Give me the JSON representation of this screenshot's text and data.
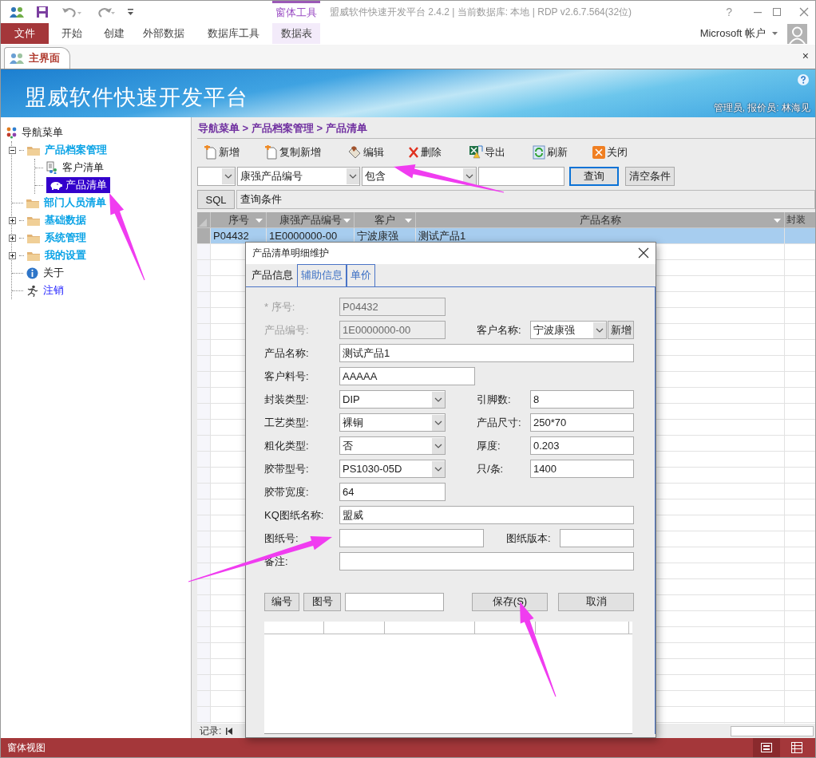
{
  "title_bar": {
    "context_group": "窗体工具",
    "title": "盟威软件快速开发平台 2.4.2 | 当前数据库: 本地 | RDP v2.6.7.564(32位)",
    "help": "?"
  },
  "ribbon": {
    "tabs": [
      {
        "label": "文件",
        "kind": "file"
      },
      {
        "label": "开始",
        "kind": "tab"
      },
      {
        "label": "创建",
        "kind": "tab"
      },
      {
        "label": "外部数据",
        "kind": "tab"
      },
      {
        "label": "数据库工具",
        "kind": "tab"
      },
      {
        "label": "数据表",
        "kind": "context"
      }
    ],
    "account": "Microsoft 帐户"
  },
  "document_tabs": {
    "tabs": [
      {
        "label": "主界面",
        "selected": true
      }
    ],
    "close": "×"
  },
  "banner": {
    "title": "盟威软件快速开发平台",
    "user": "管理员, 报价员: 林海见"
  },
  "nav": {
    "title": "导航菜单",
    "items": [
      {
        "label": "产品档案管理",
        "kind": "folder",
        "expanded": true,
        "children": [
          {
            "label": "客户清单",
            "kind": "table",
            "selected": false
          },
          {
            "label": "产品清单",
            "kind": "form",
            "selected": true
          }
        ]
      },
      {
        "label": "部门人员清单",
        "kind": "folder"
      },
      {
        "label": "基础数据",
        "kind": "folder",
        "expanded": false
      },
      {
        "label": "系统管理",
        "kind": "folder",
        "expanded": false
      },
      {
        "label": "我的设置",
        "kind": "folder",
        "expanded": false
      },
      {
        "label": "关于",
        "kind": "about"
      },
      {
        "label": "注销",
        "kind": "logout"
      }
    ]
  },
  "breadcrumb": "导航菜单 > 产品档案管理 > 产品清单",
  "toolbar": [
    {
      "label": "新增",
      "kind": "add"
    },
    {
      "label": "复制新增",
      "kind": "copy"
    },
    {
      "label": "编辑",
      "kind": "edit"
    },
    {
      "label": "删除",
      "kind": "delete"
    },
    {
      "label": "导出",
      "kind": "export"
    },
    {
      "label": "刷新",
      "kind": "refresh"
    },
    {
      "label": "关闭",
      "kind": "close"
    }
  ],
  "filter": {
    "field": "康强产品编号",
    "operator": "包含",
    "query_button": "查询",
    "clear_button": "清空条件"
  },
  "sql_bar": {
    "button": "SQL",
    "label": "查询条件"
  },
  "grid": {
    "columns": [
      "序号",
      "康强产品编号",
      "客户",
      "产品名称",
      "封装"
    ],
    "rows": [
      {
        "cells": [
          "P04432",
          "1E0000000-00",
          "宁波康强",
          "测试产品1"
        ],
        "selected": true
      }
    ]
  },
  "record_nav": {
    "label": "记录:"
  },
  "dialog": {
    "title": "产品清单明细维护",
    "tabs": [
      {
        "label": "产品信息",
        "selected": true
      },
      {
        "label": "辅助信息",
        "selected": false
      },
      {
        "label": "单价",
        "selected": false
      }
    ],
    "rows": [
      [
        {
          "label": "* 序号:",
          "value": "P04432",
          "kind": "readonly"
        }
      ],
      [
        {
          "label": "产品编号:",
          "value": "1E0000000-00",
          "kind": "readonly"
        },
        {
          "label": "客户名称:",
          "value": "宁波康强",
          "kind": "combo",
          "button": "新增"
        }
      ],
      [
        {
          "label": "产品名称:",
          "value": "测试产品1",
          "kind": "text"
        }
      ],
      [
        {
          "label": "客户料号:",
          "value": "AAAAA",
          "kind": "text"
        }
      ],
      [
        {
          "label": "封装类型:",
          "value": "DIP",
          "kind": "combo"
        },
        {
          "label": "引脚数:",
          "value": "8",
          "kind": "text"
        }
      ],
      [
        {
          "label": "工艺类型:",
          "value": "裸铜",
          "kind": "combo"
        },
        {
          "label": "产品尺寸:",
          "value": "250*70",
          "kind": "text"
        }
      ],
      [
        {
          "label": "粗化类型:",
          "value": "否",
          "kind": "combo"
        },
        {
          "label": "厚度:",
          "value": "0.203",
          "kind": "text"
        }
      ],
      [
        {
          "label": "胶带型号:",
          "value": "PS1030-05D",
          "kind": "combo"
        },
        {
          "label": "只/条:",
          "value": "1400",
          "kind": "text"
        }
      ],
      [
        {
          "label": "胶带宽度:",
          "value": "64",
          "kind": "text"
        }
      ],
      [
        {
          "label": "KQ图纸名称:",
          "value": "盟威",
          "kind": "text"
        }
      ],
      [
        {
          "label": "图纸号:",
          "kind": "text"
        },
        {
          "label": "图纸版本:",
          "kind": "text"
        }
      ],
      [
        {
          "label": "备注:",
          "kind": "text"
        }
      ]
    ],
    "lookup_buttons": [
      "编号",
      "图号"
    ],
    "actions": [
      "保存(S)",
      "取消"
    ]
  },
  "status_bar": {
    "text": "窗体视图"
  }
}
